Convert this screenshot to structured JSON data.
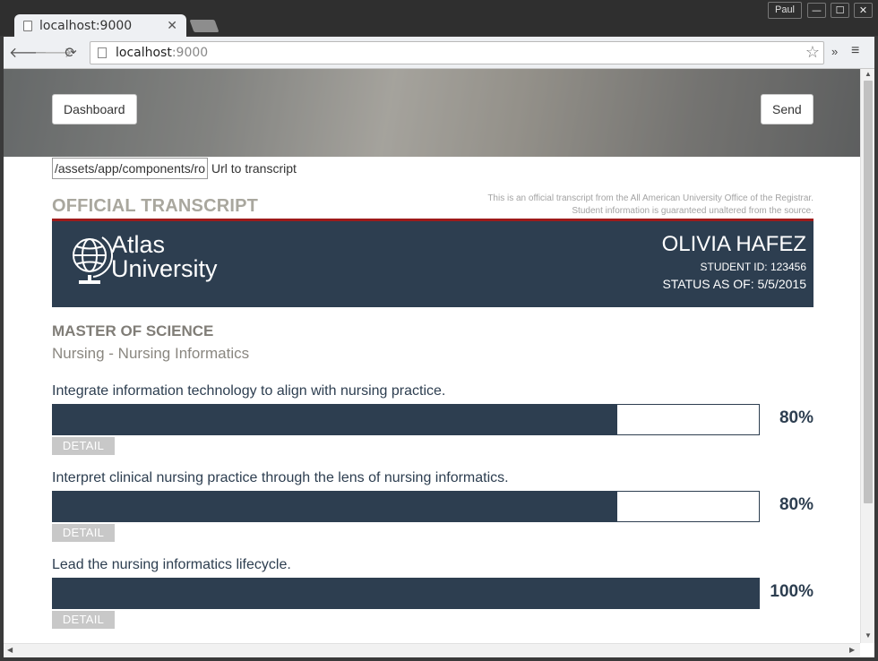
{
  "browser": {
    "tab_title": "localhost:9000",
    "tab_close": "✕",
    "profile_name": "Paul",
    "url_host": "localhost",
    "url_port": ":9000",
    "window_min": "—",
    "window_max": "☐",
    "window_close": "✕"
  },
  "header": {
    "dashboard_label": "Dashboard",
    "send_label": "Send"
  },
  "url_field": {
    "value": "/assets/app/components/ro|",
    "label": "Url to transcript"
  },
  "transcript": {
    "heading": "OFFICIAL TRANSCRIPT",
    "disclaimer_line1": "This is an official transcript from the All American University Office of the Registrar.",
    "disclaimer_line2": "Student information is guaranteed unaltered from the source.",
    "university_line1": "Atlas",
    "university_line2": "University",
    "student_name": "OLIVIA HAFEZ",
    "student_id": "STUDENT ID: 123456",
    "status": "STATUS AS OF: 5/5/2015",
    "degree": "MASTER OF SCIENCE",
    "program": "Nursing - Nursing Informatics",
    "accent_color": "#2d3e50",
    "rule_color": "#9e1b1b"
  },
  "outcomes": [
    {
      "text": "Integrate information technology to align with nursing practice.",
      "percent_label": "80%",
      "progress": 0.8,
      "detail_label": "DETAIL"
    },
    {
      "text": "Interpret clinical nursing practice through the lens of nursing informatics.",
      "percent_label": "80%",
      "progress": 0.8,
      "detail_label": "DETAIL"
    },
    {
      "text": "Lead the nursing informatics lifecycle.",
      "percent_label": "100%",
      "progress": 1.0,
      "detail_label": "DETAIL"
    }
  ]
}
